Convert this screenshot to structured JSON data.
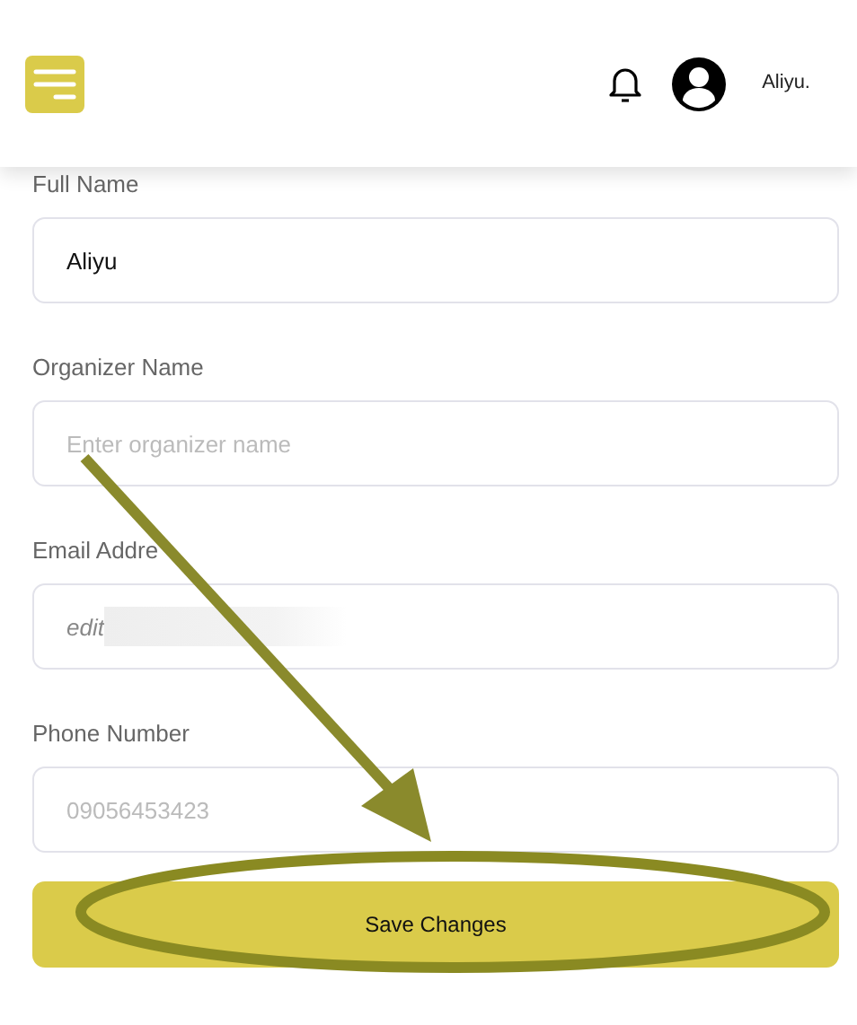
{
  "header": {
    "user_name": "Aliyu."
  },
  "fields": [
    {
      "label": "Full Name",
      "value": "Aliyu",
      "redacted": false
    },
    {
      "label": "Organizer Name",
      "placeholder": "Enter organizer name",
      "redacted": false
    },
    {
      "label": "Email Addre",
      "value": "edit",
      "redacted": true
    },
    {
      "label": "Phone Number",
      "placeholder": "09056453423",
      "redacted": false
    }
  ],
  "save_button": "Save Changes",
  "annotation": {
    "arrow": true,
    "ellipse": true
  }
}
